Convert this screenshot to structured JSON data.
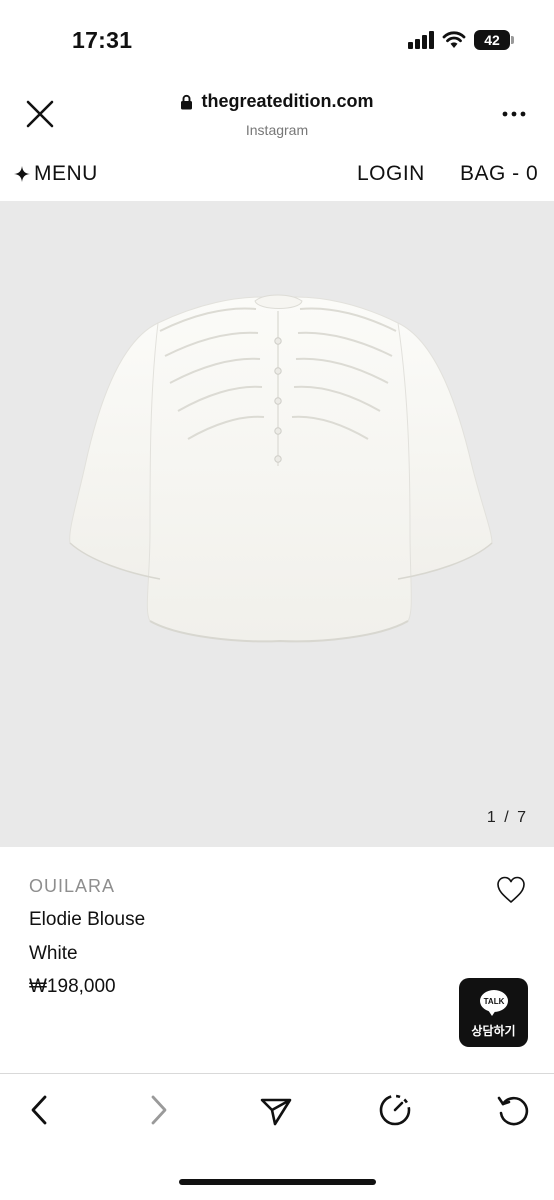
{
  "status_bar": {
    "time": "17:31",
    "battery": "42",
    "icons": [
      "signal-icon",
      "wifi-icon",
      "battery-icon"
    ]
  },
  "browser": {
    "domain": "thegreatedition.com",
    "source": "Instagram",
    "icons": [
      "close-icon",
      "lock-icon",
      "more-icon"
    ]
  },
  "site_nav": {
    "menu_icon": "sparkle-icon",
    "menu_label": "MENU",
    "login_label": "LOGIN",
    "bag_label": "BAG - 0"
  },
  "gallery": {
    "counter": "1 / 7",
    "background": "#e9e9e9"
  },
  "product": {
    "brand": "OUILARA",
    "name": "Elodie Blouse",
    "color": "White",
    "price": "₩198,000",
    "wishlist_icon": "heart-icon"
  },
  "chat": {
    "bubble_text": "TALK",
    "label": "상담하기"
  },
  "toolbar": {
    "icons": [
      "back-arrow-icon",
      "forward-arrow-icon",
      "share-send-icon",
      "timer-icon",
      "reload-icon"
    ]
  }
}
